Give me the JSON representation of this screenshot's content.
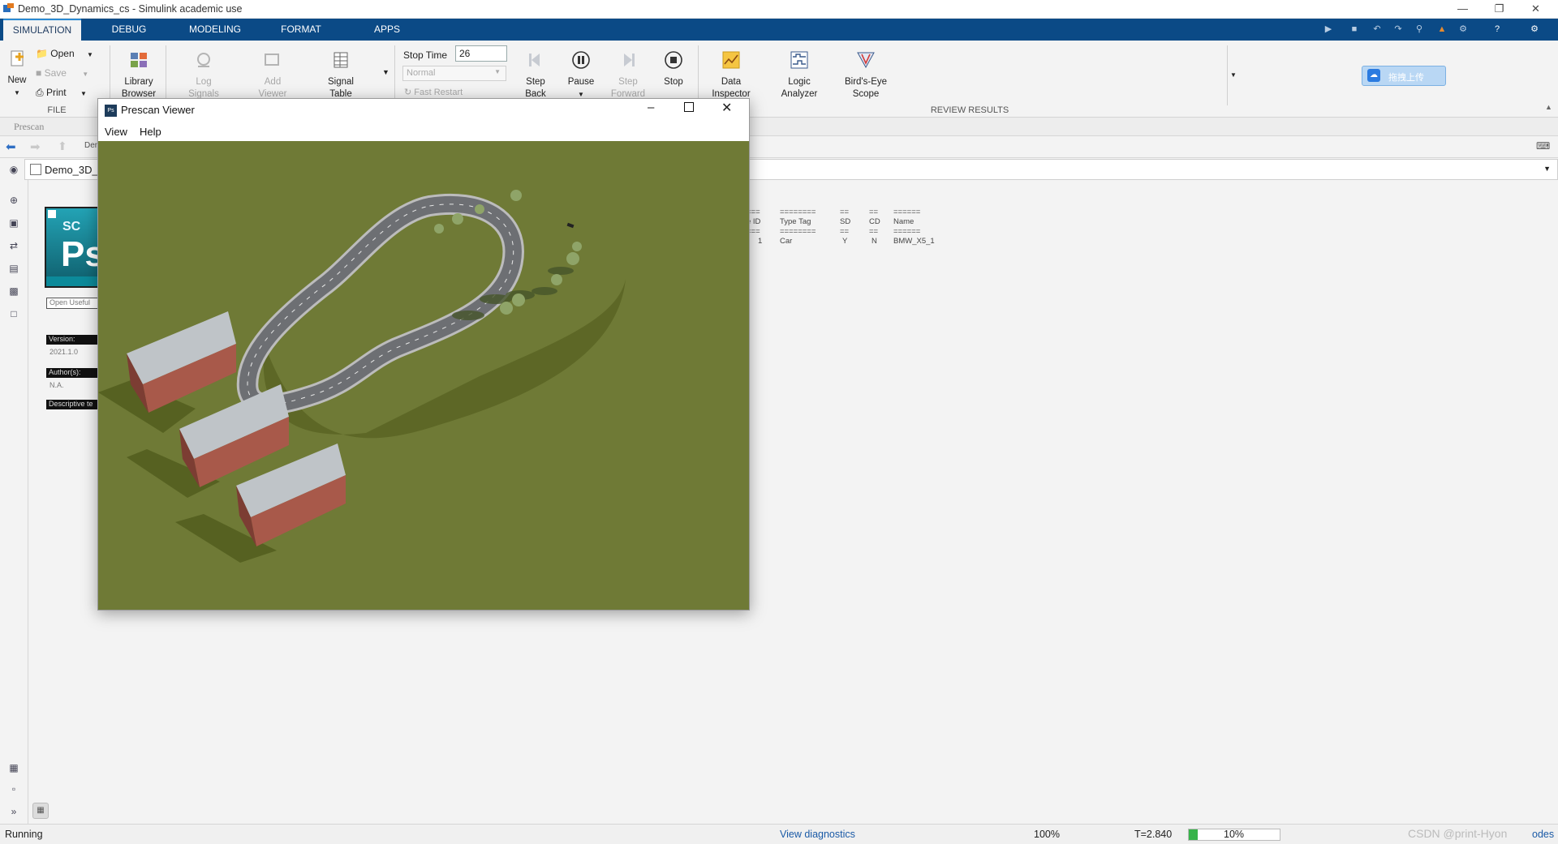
{
  "window": {
    "title": "Demo_3D_Dynamics_cs - Simulink academic use"
  },
  "ribbon_tabs": [
    "SIMULATION",
    "DEBUG",
    "MODELING",
    "FORMAT",
    "APPS"
  ],
  "file_group": {
    "new": "New",
    "open": "Open",
    "save": "Save",
    "print": "Print",
    "label": "FILE"
  },
  "library": {
    "browser": "Library Browser"
  },
  "prepare": {
    "log_signals": "Log Signals",
    "add_viewer": "Add Viewer",
    "signal_table": "Signal Table"
  },
  "simulate": {
    "stop_time_label": "Stop Time",
    "stop_time_value": "26",
    "mode": "Normal",
    "fast_restart": "Fast Restart",
    "step_back": "Step Back",
    "pause": "Pause",
    "step_forward": "Step Forward",
    "stop": "Stop"
  },
  "review": {
    "data_inspector": "Data Inspector",
    "logic_analyzer": "Logic Analyzer",
    "birds_eye_scope": "Bird's-Eye Scope",
    "label": "REVIEW RESULTS"
  },
  "cloud_button": "拖拽上传",
  "prescan_tab": "Prescan",
  "breadcrumb": {
    "short": "Den",
    "model": "Demo_3D_D"
  },
  "block": {
    "logo_top": "SC",
    "logo_main": "Ps",
    "open_useful": "Open Useful",
    "version_label": "Version:",
    "version_value": "2021.1.0",
    "authors_label": "Author(s):",
    "authors_value": "N.A.",
    "descriptive": "Descriptive te"
  },
  "actor_table": {
    "headers": [
      "e ID",
      "Type Tag",
      "SD",
      "CD",
      "Name"
    ],
    "row": [
      "1",
      "Car",
      "Y",
      "N",
      "BMW_X5_1"
    ]
  },
  "viewer": {
    "title": "Prescan Viewer",
    "menu_view": "View",
    "menu_help": "Help"
  },
  "status": {
    "state": "Running",
    "diagnostics": "View diagnostics",
    "zoom": "100%",
    "time": "T=2.840",
    "progress_text": "10%",
    "progress": 0.1,
    "watermark": "CSDN @print-Hyon",
    "right_edge": "odes"
  },
  "colors": {
    "ribbon_blue": "#0b4a86",
    "ground": "#6f7a36",
    "road": "#6d6f73"
  }
}
